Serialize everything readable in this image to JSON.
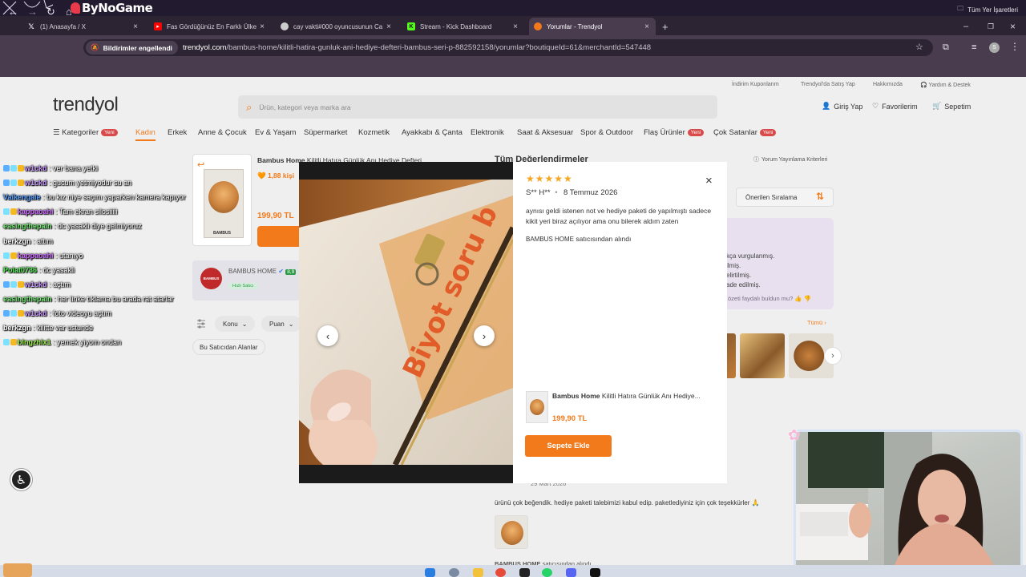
{
  "overlay": {
    "logo_text": "ByNoGame"
  },
  "browser": {
    "tabs": [
      {
        "title": "(1) Anasayfa / X",
        "icon": "x-logo-icon",
        "color": "#000000"
      },
      {
        "title": "Fas Gördüğünüz En Farklı Ülke",
        "icon": "youtube-icon",
        "color": "#ff0000"
      },
      {
        "title": "cay vakti#000 oyuncusunun Ca",
        "icon": "avatar-icon",
        "color": "#cccccc"
      },
      {
        "title": "Stream - Kick Dashboard",
        "icon": "kick-icon",
        "color": "#53fc18"
      },
      {
        "title": "Yorumlar - Trendyol",
        "icon": "trendyol-icon",
        "color": "#f27a1a"
      }
    ],
    "active_tab_index": 4,
    "notification_badge": "Bildirimler engellendi",
    "url_host": "trendyol.com",
    "url_rest": "/bambus-home/kilitli-hatira-gunluk-ani-hediye-defteri-bambus-seri-p-882592158/yorumlar?boutiqueId=61&merchantId=547448",
    "all_bookmarks": "Tüm Yer İşaretleri"
  },
  "site": {
    "logo": "trendyol",
    "top_links": [
      "İndirim Kuponlarım",
      "Trendyol'da Satış Yap",
      "Hakkımızda",
      "Yardım & Destek"
    ],
    "search_placeholder": "Ürün, kategori veya marka ara",
    "header_actions": [
      "Giriş Yap",
      "Favorilerim",
      "Sepetim"
    ],
    "nav": [
      {
        "label": "Kategoriler",
        "yeni": true
      },
      {
        "label": "Kadın",
        "active": true
      },
      {
        "label": "Erkek"
      },
      {
        "label": "Anne & Çocuk"
      },
      {
        "label": "Ev & Yaşam"
      },
      {
        "label": "Süpermarket"
      },
      {
        "label": "Kozmetik"
      },
      {
        "label": "Ayakkabı & Çanta"
      },
      {
        "label": "Elektronik"
      },
      {
        "label": "Saat & Aksesuar"
      },
      {
        "label": "Spor & Outdoor"
      },
      {
        "label": "Flaş Ürünler",
        "yeni": true
      },
      {
        "label": "Çok Satanlar",
        "yeni": true
      }
    ],
    "yeni_label": "Yeni"
  },
  "product": {
    "title_brand": "Bambus Home",
    "title": "Kilitli Hatıra Günlük Anı Hediye Defteri...",
    "rating_text": "1,88 kişi",
    "price": "199,90 TL",
    "seller": "BAMBUS HOME",
    "seller_logo": "BAMBUS",
    "seller_score": "8,9",
    "seller_badge": "Hızlı Satıcı",
    "book_brand": "BAMBUS",
    "filters": [
      "Konu",
      "Puan"
    ],
    "seller_chip": "Bu Satıcıdan Alanlar"
  },
  "reviews": {
    "title": "Tüm Değerlendirmeler",
    "criteria": "Yorum Yayınlama Kriterleri",
    "sort": "Önerilen Sıralama",
    "summary_lines": [
      "kça vurgulanmış.",
      "ilmiş.",
      "elirtilmiş.",
      "ade edilmiş."
    ],
    "summary_feedback": "özeti faydalı buldun mu?",
    "photos_all": "Tümü",
    "second_review": {
      "date": "29 Mart 2026",
      "text": "ürünü çok beğendik. hediye paketi talebimizi kabul edip. paketlediyiniz için çok teşekkürler 🙏",
      "seller_prefix": "BAMBUS HOME",
      "seller_suffix": "satıcısından alındı"
    }
  },
  "modal": {
    "stars": "★★★★★",
    "user": "S** H**",
    "date": "8 Temmuz 2026",
    "text": "aynısı geldi istenen not ve hediye paketi de yapılmıştı sadece kikit yeri biraz açılıyor ama onu bilerek aldım zaten",
    "seller_prefix": "BAMBUS HOME",
    "seller_suffix": "satıcısından alındı",
    "product_brand": "Bambus Home",
    "product_title": "Kilitli Hatıra Günlük Anı Hediye...",
    "product_price": "199,90 TL",
    "cart_button": "Sepete Ekle",
    "photo_text": "Biyot soru b"
  },
  "chat": [
    {
      "user": "w1ckd",
      "msg": "ver bana yetki",
      "color": "#c896ff"
    },
    {
      "user": "w1ckd",
      "msg": "gucum yetmiyodur su an",
      "color": "#c896ff"
    },
    {
      "user": "Valkengale",
      "msg": "bu kız niye saçını yaparken kamera kapıyor",
      "color": "#5aa0ff"
    },
    {
      "user": "kappaoahi",
      "msg": "Tam ekran silosiiiii",
      "color": "#d070ff"
    },
    {
      "user": "easingthepain",
      "msg": "dc yasakli diye gelmiyoruz",
      "color": "#7cf07c"
    },
    {
      "user": "berkzgn",
      "msg": "attım",
      "color": "#ffffff"
    },
    {
      "user": "kappaoahi",
      "msg": "utanıyo",
      "color": "#d070ff"
    },
    {
      "user": "Polat0736",
      "msg": "dc yasakli",
      "color": "#5cf05c"
    },
    {
      "user": "w1ckd",
      "msg": "açtım",
      "color": "#c896ff"
    },
    {
      "user": "easingthepain",
      "msg": "her linke tıklama bu arada rat atarlar",
      "color": "#7cf07c"
    },
    {
      "user": "w1ckd",
      "msg": "foto videoyu açtım",
      "color": "#c896ff"
    },
    {
      "user": "berkzgn",
      "msg": "kilitte var ustunde",
      "color": "#ffffff"
    },
    {
      "user": "blngzhlx1",
      "msg": "yemek yiyom ondan",
      "color": "#9cf04c"
    }
  ],
  "colors": {
    "accent": "#f27a1a",
    "browser_frame": "#493c4f"
  }
}
